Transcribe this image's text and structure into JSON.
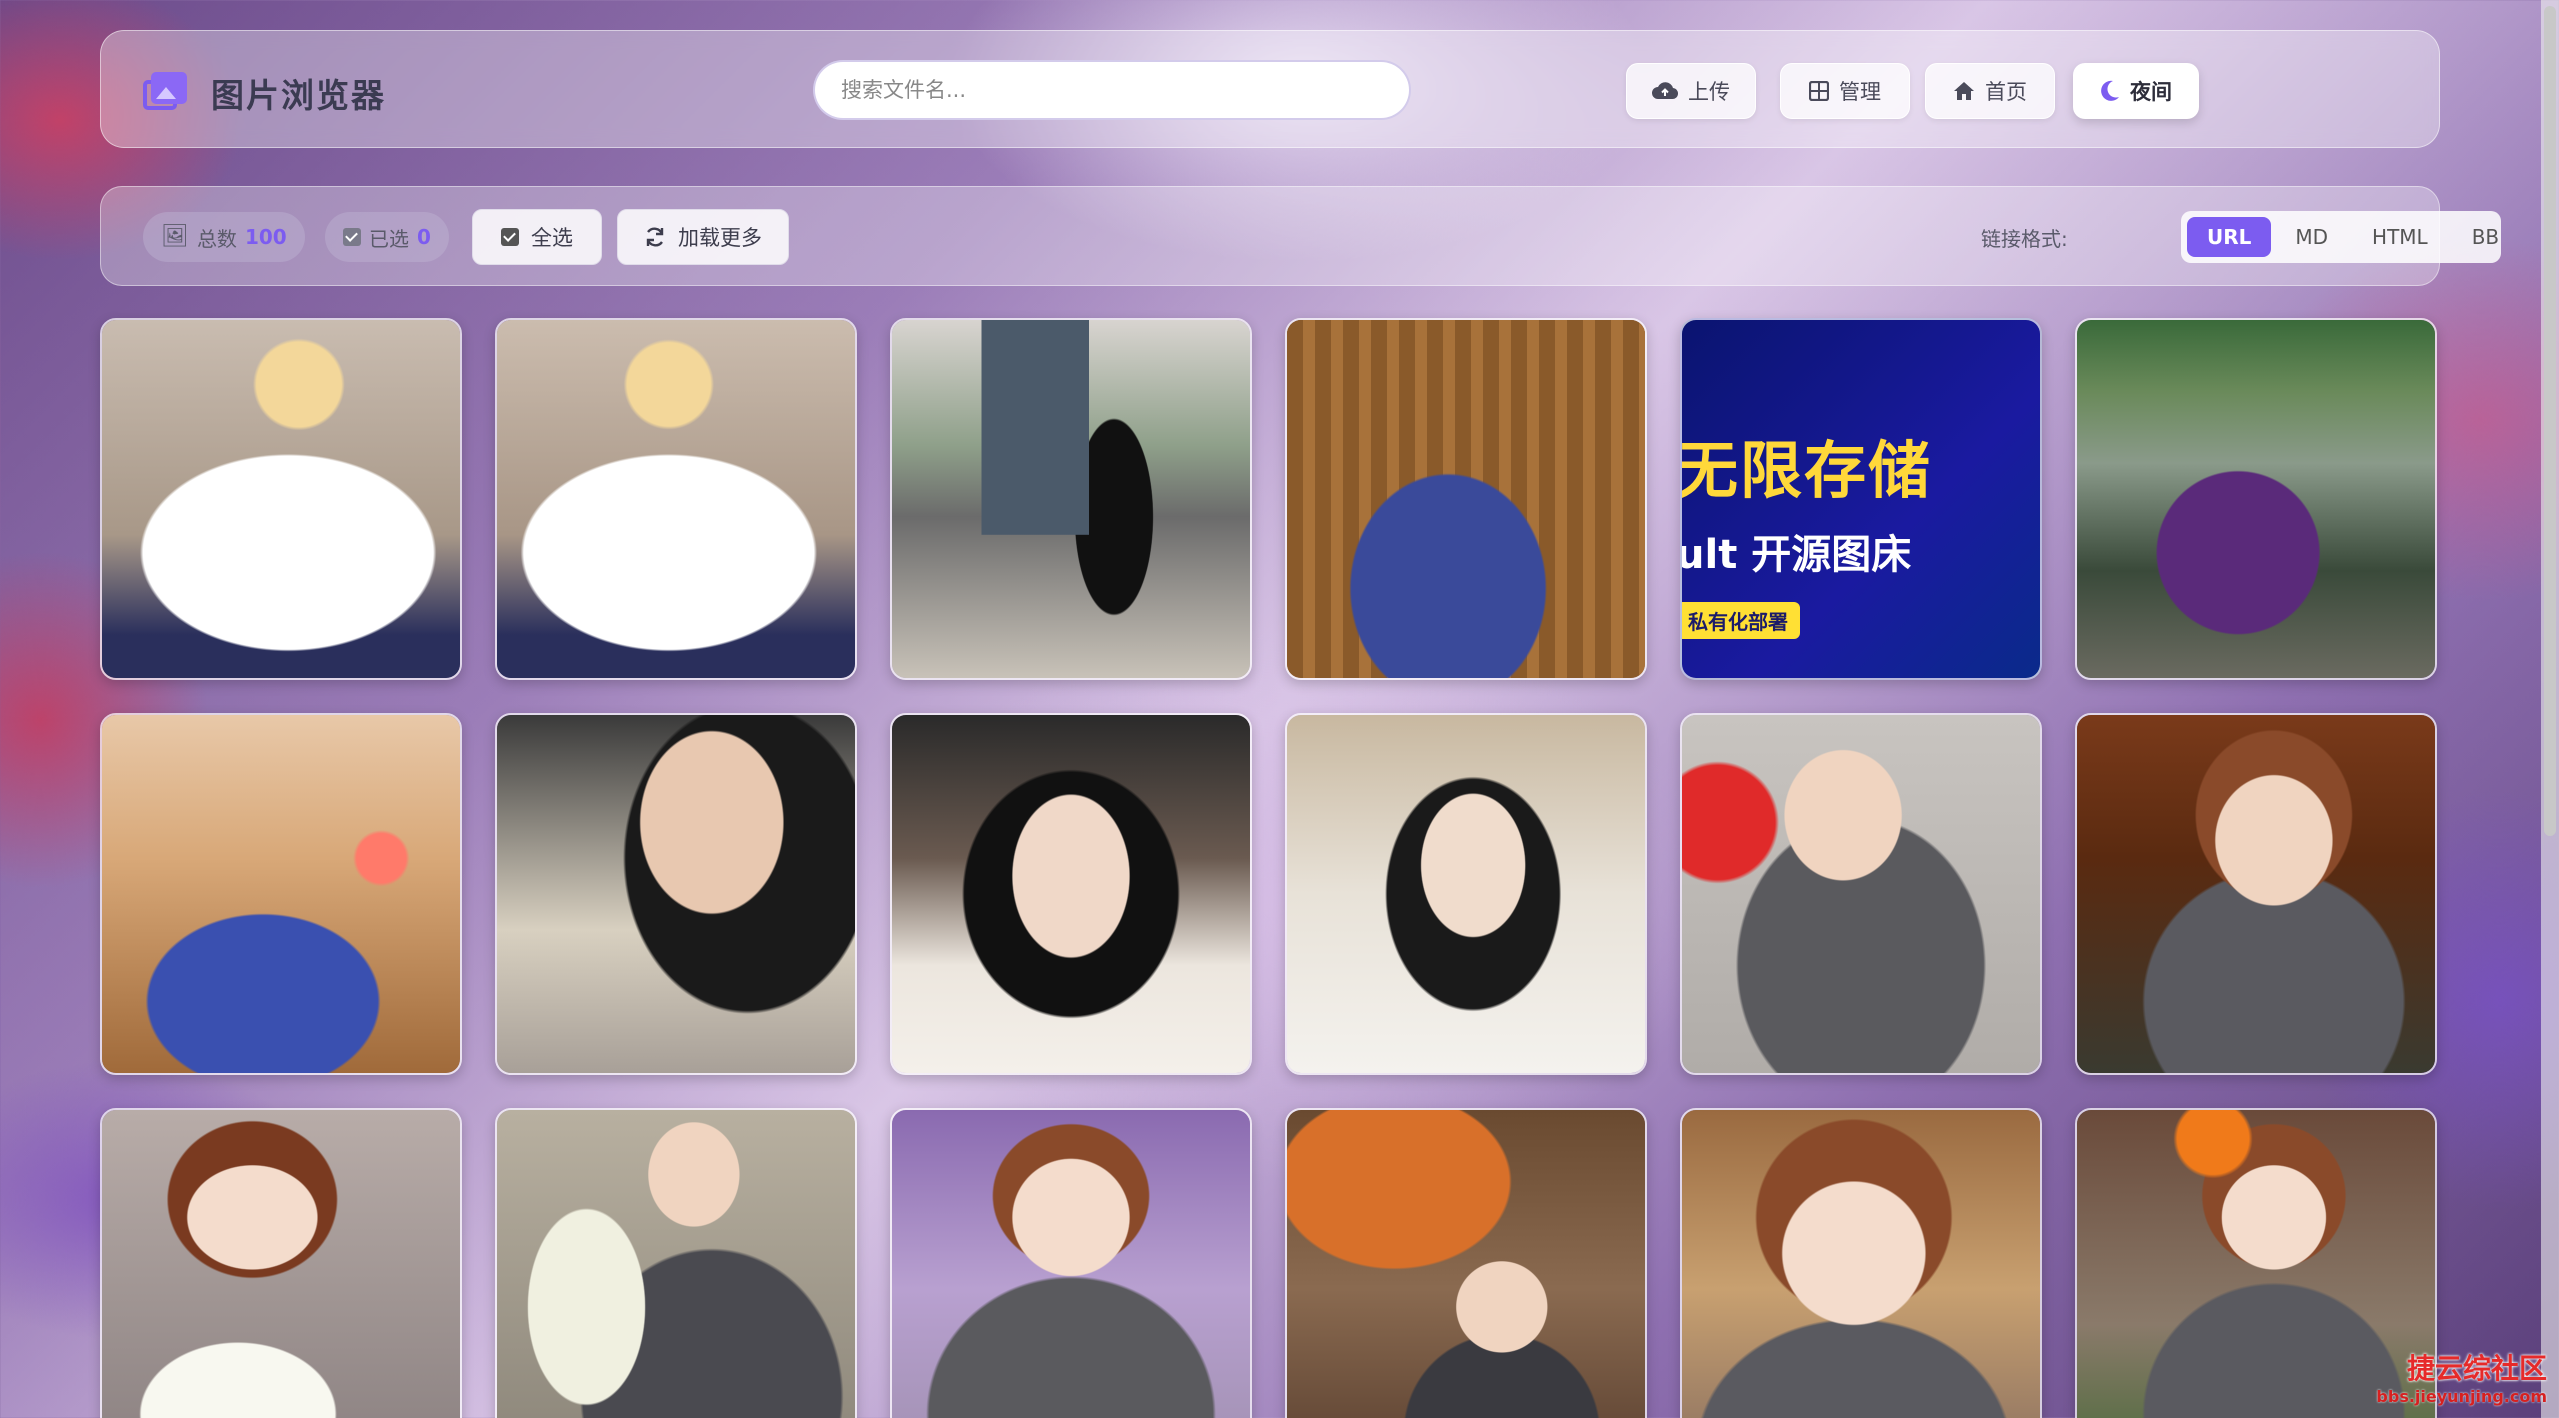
{
  "header": {
    "title": "图片浏览器",
    "search_placeholder": "搜索文件名...",
    "buttons": {
      "upload": "上传",
      "manage": "管理",
      "home": "首页",
      "night": "夜间"
    }
  },
  "toolbar": {
    "total_label": "总数",
    "total_count": "100",
    "selected_label": "已选",
    "selected_count": "0",
    "select_all": "全选",
    "load_more": "加载更多",
    "format_label": "链接格式:",
    "formats": [
      "URL",
      "MD",
      "HTML",
      "BB"
    ],
    "active_format": "URL"
  },
  "promo": {
    "line1": "无限存储",
    "line2": "ult 开源图床",
    "badge": "私有化部署"
  },
  "watermark": {
    "text": "捷云综社区",
    "url": "bbs.jieyunjing.com"
  },
  "colors": {
    "accent": "#7c5cf0"
  }
}
